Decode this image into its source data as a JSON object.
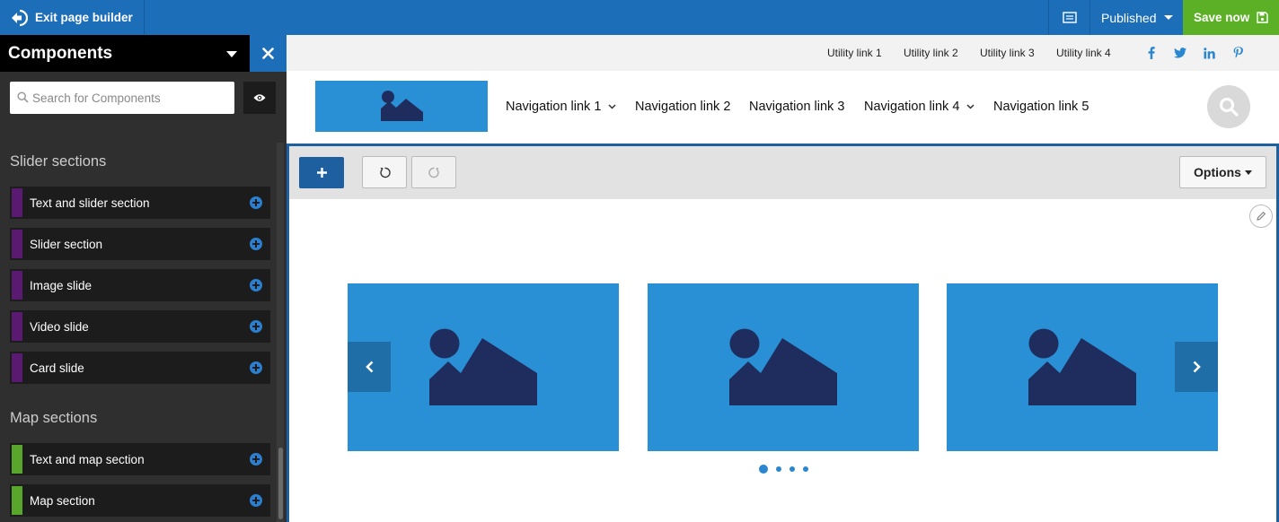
{
  "topbar": {
    "exit_label": "Exit page builder",
    "status_label": "Published",
    "save_label": "Save now"
  },
  "panel": {
    "title": "Components",
    "search_placeholder": "Search for Components",
    "sections": [
      {
        "heading": "Slider sections",
        "color": "#5a1a72",
        "items": [
          "Text and slider section",
          "Slider section",
          "Image slide",
          "Video slide",
          "Card slide"
        ]
      },
      {
        "heading": "Map sections",
        "color": "#59a62c",
        "items": [
          "Text and map section",
          "Map section"
        ]
      }
    ]
  },
  "site": {
    "utility_links": [
      "Utility link 1",
      "Utility link 2",
      "Utility link 3",
      "Utility link 4"
    ],
    "social_icons": [
      "facebook-icon",
      "twitter-icon",
      "linkedin-icon",
      "pinterest-icon"
    ],
    "nav_links": [
      {
        "label": "Navigation link 1",
        "has_dropdown": true
      },
      {
        "label": "Navigation link 2",
        "has_dropdown": false
      },
      {
        "label": "Navigation link 3",
        "has_dropdown": false
      },
      {
        "label": "Navigation link 4",
        "has_dropdown": true
      },
      {
        "label": "Navigation link 5",
        "has_dropdown": false
      }
    ]
  },
  "editor": {
    "options_label": "Options",
    "slider_dots": 4,
    "active_dot": 1
  },
  "colors": {
    "accent": "#1d6eb8",
    "save": "#5cb025",
    "placeholder_blue": "#2a90d5",
    "placeholder_navy": "#1f2d5e"
  }
}
